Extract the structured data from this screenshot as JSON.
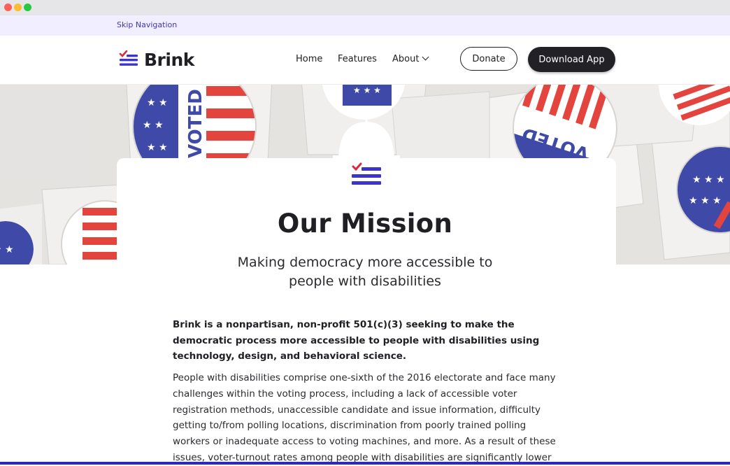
{
  "skip": {
    "label": "Skip Navigation"
  },
  "brand": {
    "name": "Brink",
    "accent": "#3d35c9",
    "check_color": "#e0263f"
  },
  "nav": {
    "items": [
      "Home",
      "Features",
      "About"
    ],
    "donate_label": "Donate",
    "download_label": "Download App"
  },
  "hero": {
    "sticker_text": "VOTED",
    "sticker_colors": {
      "blue": "#2f3aa0",
      "red": "#e2352e",
      "white": "#ffffff"
    }
  },
  "mission": {
    "title": "Our Mission",
    "subtitle": "Making democracy more accessible to people with disabilities",
    "lead": "Brink is a nonpartisan, non-profit 501(c)(3) seeking to make the democratic process more accessible to people with disabilities using technology, design, and behavioral science.",
    "body": "People with disabilities comprise one-sixth of the 2016 electorate and face many challenges within the voting process, including a lack of accessible voter registration methods, unaccessible candidate and issue information, difficulty getting to/from polling locations, discrimination from poorly trained polling workers or inadequate access to voting machines, and more. As a result of these issues, voter-turnout rates among people with disabilities are significantly lower"
  }
}
